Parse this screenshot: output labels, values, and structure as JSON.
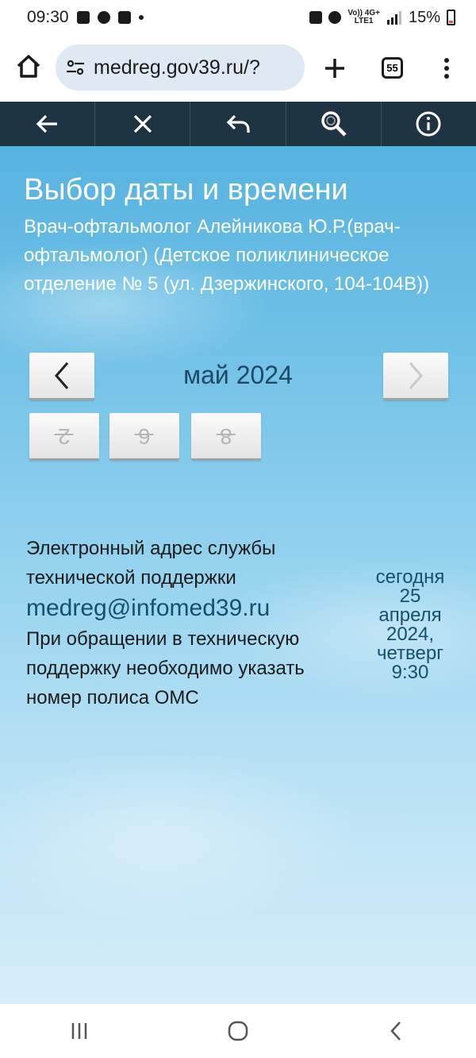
{
  "status_bar": {
    "time": "09:30",
    "network_top": "Vo)) 4G+",
    "network_bottom": "LTE1",
    "battery": "15%"
  },
  "browser": {
    "url": "medreg.gov39.ru/?",
    "tab_count": "55"
  },
  "page": {
    "title": "Выбор даты и времени",
    "subtitle": "Врач-офтальмолог Алейникова Ю.Р.(врач-офтальмолог) (Детское поликлиническое отделение № 5 (ул. Дзержинского, 104-104В))",
    "month": "май 2024",
    "days": [
      "2",
      "6",
      "8"
    ]
  },
  "support": {
    "line1": "Электронный адрес службы технической поддержки",
    "email": "medreg@infomed39.ru",
    "note": "При обращении в техническую поддержку необходимо указать номер полиса ОМС"
  },
  "today": {
    "label": "сегодня",
    "day": "25",
    "month": "апреля",
    "year": "2024,",
    "weekday": "четверг",
    "time": "9:30"
  },
  "colors": {
    "toolbar_bg": "#1e3443",
    "title_text": "#ffffff",
    "link_text": "#13516f",
    "url_box": "#dfe9f3"
  }
}
